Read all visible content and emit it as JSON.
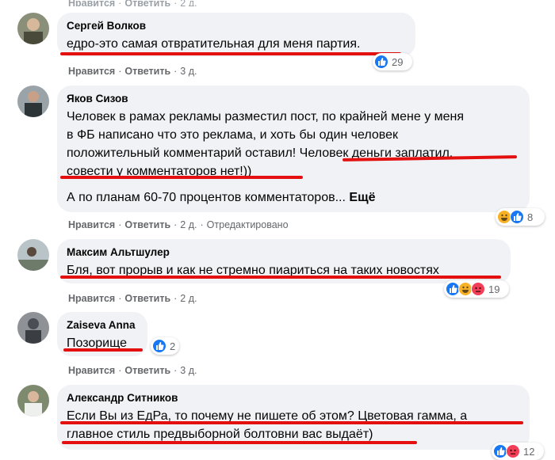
{
  "top_fragment": {
    "like_label": "Нравится",
    "reply_label": "Ответить",
    "time": "2 д."
  },
  "comments": [
    {
      "author": "Сергей Волков",
      "text": "едро-это самая отвратительная для меня партия.",
      "like_label": "Нравится",
      "reply_label": "Ответить",
      "time": "3 д.",
      "reaction_count": "29"
    },
    {
      "author": "Яков Сизов",
      "text_lines": [
        "Человек в рамах рекламы разместил пост, по крайней мене у меня",
        "в ФБ написано что это реклама, и хоть бы один человек",
        "положительный комментарий оставил! Человек деньги заплатил,",
        "совести у комментаторов нет!))"
      ],
      "text2": "А по планам 60-70 процентов комментаторов...",
      "more_label": "Ещё",
      "like_label": "Нравится",
      "reply_label": "Ответить",
      "time": "2 д.",
      "edited_label": "Отредактировано",
      "reaction_count": "8"
    },
    {
      "author": "Максим Альтшулер",
      "text": "Бля, вот прорыв и как не стремно пиариться на таких новостях",
      "like_label": "Нравится",
      "reply_label": "Ответить",
      "time": "2 д.",
      "reaction_count": "19"
    },
    {
      "author": "Zaiseva Anna",
      "text": "Позорище",
      "like_label": "Нравится",
      "reply_label": "Ответить",
      "time": "3 д.",
      "reaction_count": "2"
    },
    {
      "author": "Александр Ситников",
      "text_lines": [
        "Если Вы из ЕдРа, то почему не пишете об этом? Цветовая гамма, а",
        "главное стиль предвыборной болтовни вас выдаёт)"
      ],
      "reaction_count": "12"
    }
  ],
  "colors": {
    "bubble": "#f0f2f5",
    "underline": "#e41010",
    "like_blue": "#1877f2",
    "love_red": "#f33e58",
    "haha_yellow": "#f7b125"
  }
}
